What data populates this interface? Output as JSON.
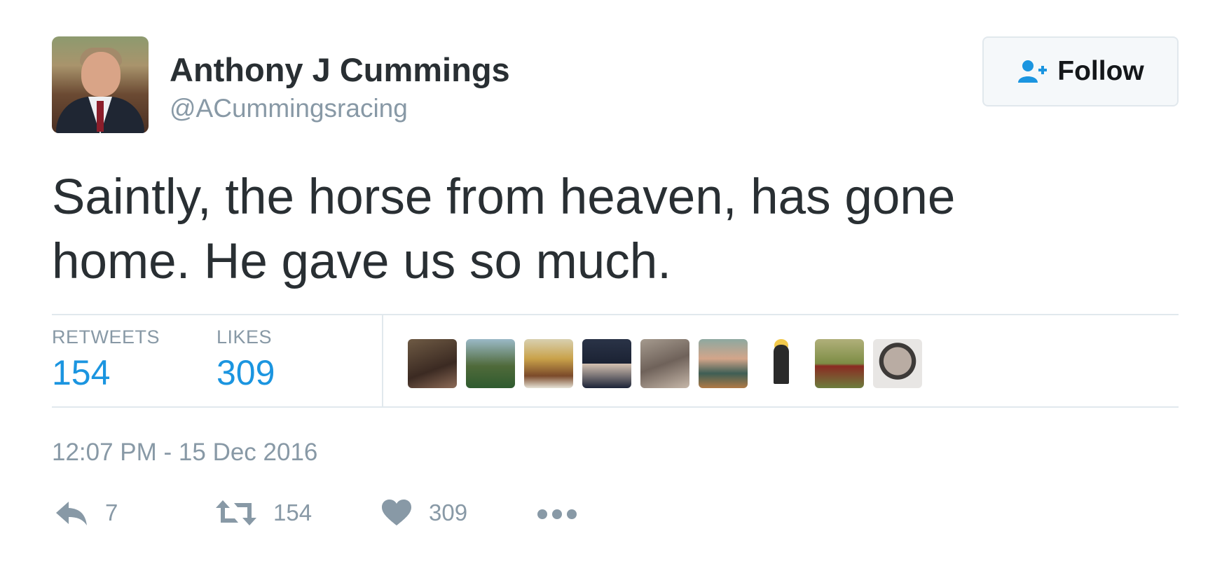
{
  "author": {
    "name": "Anthony J Cummings",
    "handle": "@ACummingsracing"
  },
  "follow_button": {
    "label": "Follow",
    "icon": "follow-user-icon"
  },
  "tweet": {
    "text_line1": "Saintly, the horse from heaven, has gone",
    "text_line2": "home. He gave us so much."
  },
  "stats": {
    "retweets_label": "RETWEETS",
    "retweets_value": "154",
    "likes_label": "LIKES",
    "likes_value": "309"
  },
  "likers_count_shown": 9,
  "timestamp": "12:07 PM - 15 Dec 2016",
  "actions": {
    "reply_icon": "reply-icon",
    "reply_count": "7",
    "retweet_icon": "retweet-icon",
    "retweet_count": "154",
    "like_icon": "heart-icon",
    "like_count": "309",
    "more_icon": "more-icon"
  },
  "colors": {
    "link_blue": "#1b95e0",
    "muted_gray": "#8899a6",
    "text_dark": "#292f33",
    "border": "#e1e8ed"
  }
}
